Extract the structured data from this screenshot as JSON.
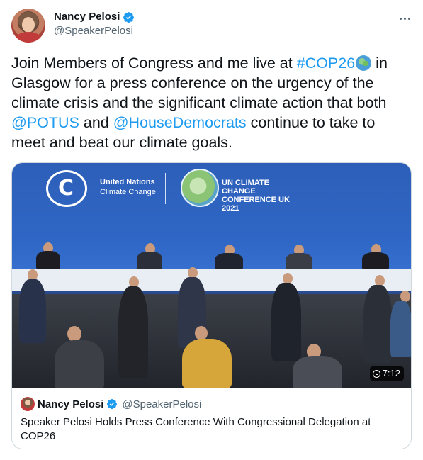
{
  "author": {
    "display_name": "Nancy Pelosi",
    "handle": "@SpeakerPelosi",
    "verified": true
  },
  "tweet": {
    "text_1": "Join Members of Congress and me live at ",
    "hashtag": "#COP26",
    "emoji": "globe-icon",
    "text_2": " in Glasgow for a press conference on the urgency of the climate crisis and the significant climate action that both ",
    "mention_1": "@POTUS",
    "text_3": " and ",
    "mention_2": "@HouseDemocrats",
    "text_4": " continue to take to meet and beat our climate goals."
  },
  "media": {
    "un_label_1": "United Nations",
    "un_label_2": "Climate Change",
    "cop_label": "UN CLIMATE CHANGE CONFERENCE UK 2021",
    "duration": "7:12"
  },
  "card": {
    "author_name": "Nancy Pelosi",
    "author_handle": "@SpeakerPelosi",
    "title": "Speaker Pelosi Holds Press Conference With Congressional Delegation at COP26"
  },
  "colors": {
    "link": "#1d9bf0",
    "secondary_text": "#536471",
    "border": "#cfd9de"
  }
}
